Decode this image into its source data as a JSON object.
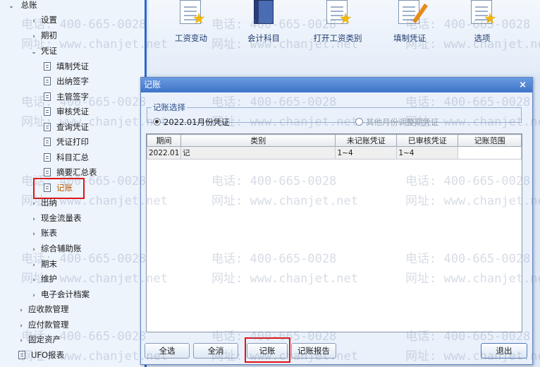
{
  "tree": {
    "root": "总账",
    "items": [
      {
        "label": "设置",
        "level": 1,
        "arrow": "›"
      },
      {
        "label": "期初",
        "level": 1,
        "arrow": "›"
      },
      {
        "label": "凭证",
        "level": 1,
        "arrow": "⌄"
      },
      {
        "label": "填制凭证",
        "level": 2
      },
      {
        "label": "出纳签字",
        "level": 2
      },
      {
        "label": "主管签字",
        "level": 2
      },
      {
        "label": "审核凭证",
        "level": 2
      },
      {
        "label": "查询凭证",
        "level": 2
      },
      {
        "label": "凭证打印",
        "level": 2
      },
      {
        "label": "科目汇总",
        "level": 2
      },
      {
        "label": "摘要汇总表",
        "level": 2
      },
      {
        "label": "记账",
        "level": 2
      },
      {
        "label": "出纳",
        "level": 1,
        "arrow": "›"
      },
      {
        "label": "现金流量表",
        "level": 1,
        "arrow": "›"
      },
      {
        "label": "账表",
        "level": 1,
        "arrow": "›"
      },
      {
        "label": "综合辅助账",
        "level": 1,
        "arrow": "›"
      },
      {
        "label": "期末",
        "level": 1,
        "arrow": "›"
      },
      {
        "label": "维护",
        "level": 1,
        "arrow": "›"
      },
      {
        "label": "电子会计档案",
        "level": 1,
        "arrow": "›"
      },
      {
        "label": "应收款管理",
        "level": 0,
        "arrow": "›"
      },
      {
        "label": "应付款管理",
        "level": 0,
        "arrow": "›"
      },
      {
        "label": "固定资产",
        "level": 0,
        "arrow": "›"
      },
      {
        "label": "UFO报表",
        "level": 0
      }
    ]
  },
  "toolbar": {
    "items": [
      "工资变动",
      "会计科目",
      "打开工资类别",
      "填制凭证",
      "选项"
    ]
  },
  "dialog": {
    "title": "记账",
    "close": "×",
    "group_label": "记账选择",
    "radio_current": "2022.01月份凭证",
    "radio_other": "其他月份调整期凭证",
    "columns": [
      "期间",
      "类别",
      "未记账凭证",
      "已审核凭证",
      "记账范围"
    ],
    "rows": [
      [
        "2022.01",
        "记",
        "1~4",
        "1~4",
        ""
      ]
    ],
    "buttons": {
      "select_all": "全选",
      "clear_all": "全消",
      "post": "记账",
      "report": "记账报告",
      "exit": "退出"
    }
  },
  "watermark": {
    "phone": "电话: 400-665-0028",
    "url": "网址: www.chanjet.net"
  }
}
